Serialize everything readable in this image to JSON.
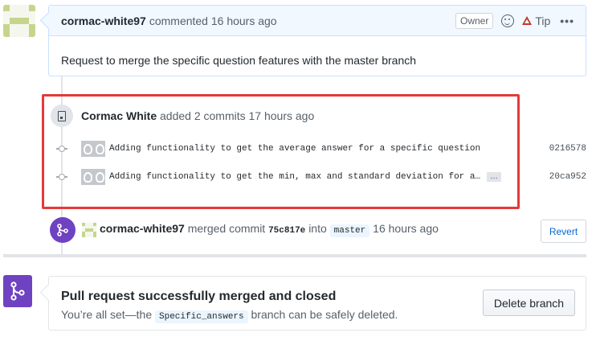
{
  "comment": {
    "author": "cormac-white97",
    "action_time": "commented 16 hours ago",
    "owner_label": "Owner",
    "tip_label": "Tip",
    "more_label": "•••",
    "body": "Request to merge the specific question features with the master branch"
  },
  "commits": {
    "author": "Cormac White",
    "summary": "added 2 commits 17 hours ago",
    "items": [
      {
        "message": "Adding functionality to get the average answer for a specific question",
        "sha": "0216578",
        "has_ellipsis": false
      },
      {
        "message": "Adding functionality to get the min, max and standard deviation for a…",
        "sha": "20ca952",
        "has_ellipsis": true
      }
    ],
    "ellipsis_label": "…"
  },
  "merge_event": {
    "author": "cormac-white97",
    "merged_text": "merged commit",
    "commit_sha": "75c817e",
    "into_text": "into",
    "target_branch": "master",
    "time": "16 hours ago",
    "revert_label": "Revert"
  },
  "merge_status": {
    "title": "Pull request successfully merged and closed",
    "sub_before": "You’re all set—the",
    "branch": "Specific_answers",
    "sub_after": "branch can be safely deleted.",
    "delete_label": "Delete branch"
  },
  "colors": {
    "highlight": "#e5393a",
    "merged_purple": "#6f42c1",
    "link_blue": "#0366d6"
  }
}
